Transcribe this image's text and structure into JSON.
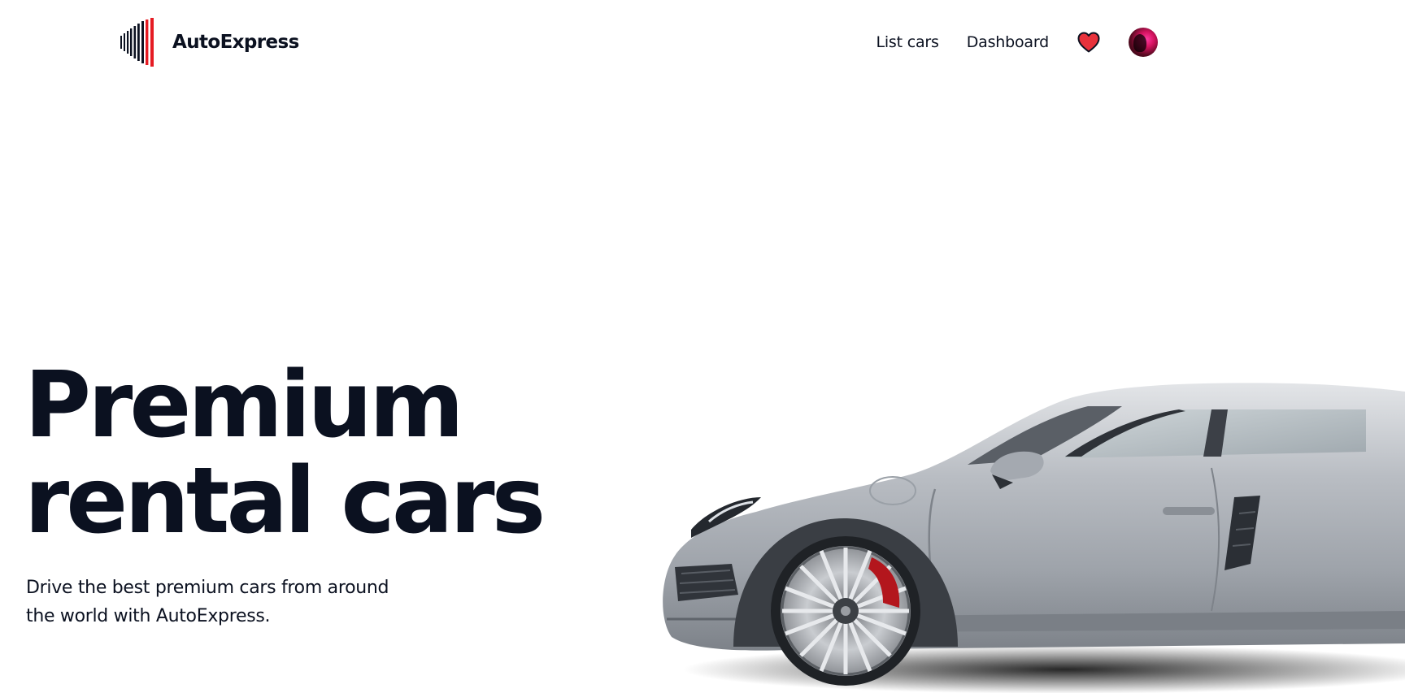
{
  "header": {
    "brand_name": "AutoExpress",
    "nav": {
      "list_cars": "List cars",
      "dashboard": "Dashboard"
    },
    "favorites_icon": "heart-icon",
    "avatar_icon": "user-avatar"
  },
  "hero": {
    "title_line1": "Premium",
    "title_line2": "rental cars",
    "subtitle_line1": "Drive the best premium cars from around",
    "subtitle_line2": "the world with AutoExpress."
  },
  "colors": {
    "text": "#0b1120",
    "accent": "#e51b23",
    "heart": "#e8323c",
    "background": "#ffffff"
  }
}
